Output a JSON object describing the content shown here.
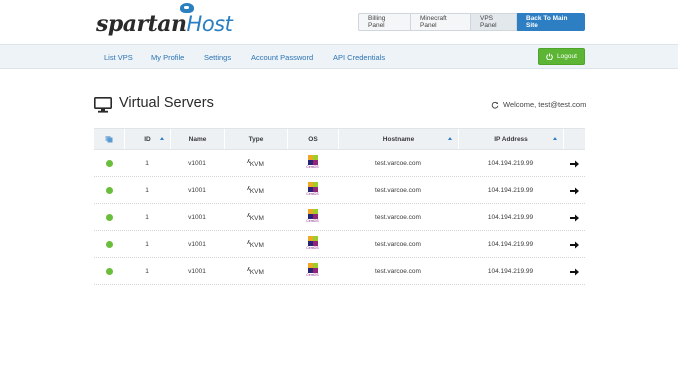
{
  "brand": {
    "logo_main": "spartan",
    "logo_accent": "Host",
    "accent_color": "#2d7ec2"
  },
  "top_nav": {
    "billing": "Billing Panel",
    "minecraft": "Minecraft Panel",
    "vps": "VPS Panel",
    "main_site": "Back To Main Site"
  },
  "nav": {
    "items": [
      "List VPS",
      "My Profile",
      "Settings",
      "Account Password",
      "API Credentials"
    ],
    "logout": "Logout"
  },
  "page": {
    "title": "Virtual Servers",
    "welcome": "Welcome, test@test.com"
  },
  "table": {
    "headers": {
      "status": "",
      "id": "ID",
      "name": "Name",
      "type": "Type",
      "os": "OS",
      "hostname": "Hostname",
      "ip": "IP Address"
    },
    "rows": [
      {
        "status": "online",
        "id": "1",
        "name": "v1001",
        "type": "KVM",
        "os": "CentOS",
        "hostname": "test.varcoe.com",
        "ip": "104.194.219.99"
      },
      {
        "status": "online",
        "id": "1",
        "name": "v1001",
        "type": "KVM",
        "os": "CentOS",
        "hostname": "test.varcoe.com",
        "ip": "104.194.219.99"
      },
      {
        "status": "online",
        "id": "1",
        "name": "v1001",
        "type": "KVM",
        "os": "CentOS",
        "hostname": "test.varcoe.com",
        "ip": "104.194.219.99"
      },
      {
        "status": "online",
        "id": "1",
        "name": "v1001",
        "type": "KVM",
        "os": "CentOS",
        "hostname": "test.varcoe.com",
        "ip": "104.194.219.99"
      },
      {
        "status": "online",
        "id": "1",
        "name": "v1001",
        "type": "KVM",
        "os": "CentOS",
        "hostname": "test.varcoe.com",
        "ip": "104.194.219.99"
      }
    ]
  },
  "colors": {
    "status_online": "#6bbd3c",
    "logout_green": "#5cb534",
    "link_blue": "#2c73b4"
  }
}
